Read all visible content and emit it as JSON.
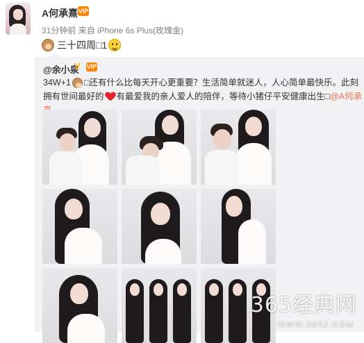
{
  "author": {
    "name": "A何承熹",
    "vip_label": "VIP"
  },
  "meta": {
    "time": "31分钟前",
    "source": "来自 iPhone 6s Plus(玫瑰金)"
  },
  "post": {
    "text": "三十四周□1",
    "emoji_start": "monkey-icon",
    "emoji_end": "smile-icon"
  },
  "repost": {
    "author": "@余小泉",
    "verified_mark": "V",
    "vip_label": "VIP",
    "text_part1": "34W+1",
    "text_part2": "□还有什么比每天开心更重要？生活简单就迷人，人心简单最快乐。此刻拥有世间最好的",
    "text_part3": "有最爱我的亲人爱人的陪伴，等待小猪仔平安健康出生□",
    "mention": "@A何承熹"
  },
  "photos": [
    {
      "name": "photo-1",
      "scene": "couple"
    },
    {
      "name": "photo-2",
      "scene": "couple-kiss"
    },
    {
      "name": "photo-3",
      "scene": "couple"
    },
    {
      "name": "photo-4",
      "scene": "portrait"
    },
    {
      "name": "photo-5",
      "scene": "portrait-arm"
    },
    {
      "name": "photo-6",
      "scene": "portrait-side"
    },
    {
      "name": "photo-7",
      "scene": "portrait"
    },
    {
      "name": "photo-8",
      "scene": "triple"
    },
    {
      "name": "photo-9",
      "scene": "triple"
    }
  ],
  "watermark": {
    "brand": "365经典网",
    "url": "WWW.365J.COM"
  },
  "colors": {
    "accent": "#eb7350",
    "vip": "#ff8200",
    "repost_bg": "#f2f2f5"
  }
}
